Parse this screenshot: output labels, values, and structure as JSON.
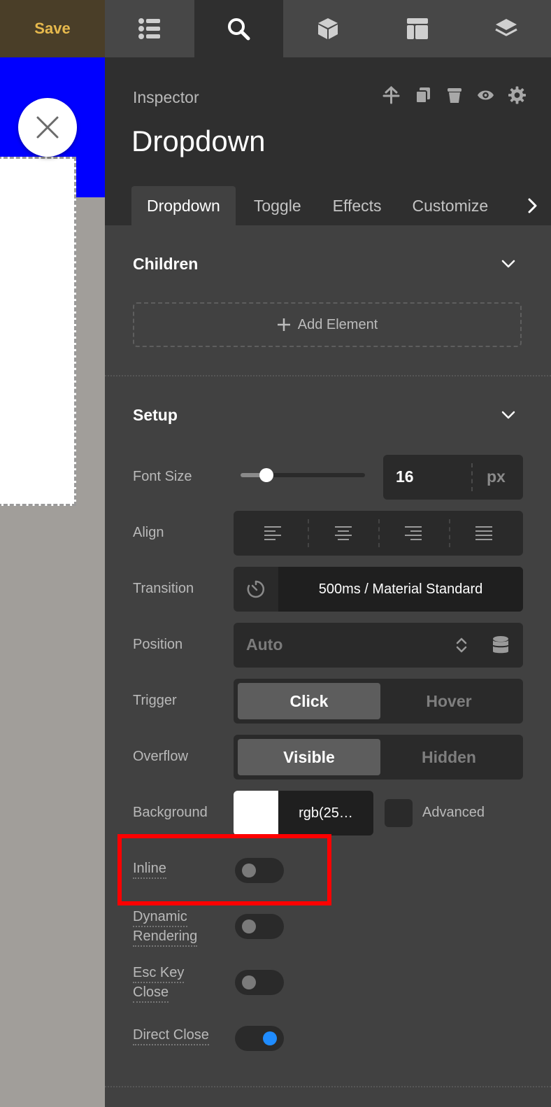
{
  "canvas": {
    "save_label": "Save"
  },
  "topbar": {
    "tabs": [
      "list",
      "search",
      "box",
      "layout",
      "layers"
    ],
    "active": "search"
  },
  "inspector": {
    "label": "Inspector",
    "title": "Dropdown",
    "actions": [
      "move-up-icon",
      "duplicate-icon",
      "delete-icon",
      "visibility-icon",
      "settings-icon"
    ],
    "tabs": [
      "Dropdown",
      "Toggle",
      "Effects",
      "Customize"
    ],
    "active_tab": "Dropdown"
  },
  "children": {
    "title": "Children",
    "add_element": "Add Element"
  },
  "setup": {
    "title": "Setup",
    "font_size": {
      "label": "Font Size",
      "value": "16",
      "unit": "px"
    },
    "align": {
      "label": "Align"
    },
    "transition": {
      "label": "Transition",
      "value": "500ms / Material Standard"
    },
    "position": {
      "label": "Position",
      "value": "Auto"
    },
    "trigger": {
      "label": "Trigger",
      "options": [
        "Click",
        "Hover"
      ],
      "selected": "Click"
    },
    "overflow": {
      "label": "Overflow",
      "options": [
        "Visible",
        "Hidden"
      ],
      "selected": "Visible"
    },
    "background": {
      "label": "Background",
      "value": "rgb(25…",
      "swatch": "#ffffff",
      "advanced_label": "Advanced"
    },
    "inline": {
      "label": "Inline",
      "on": false
    },
    "dynamic_rendering": {
      "label_1": "Dynamic",
      "label_2": "Rendering",
      "on": false
    },
    "esc_key_close": {
      "label_1": "Esc Key",
      "label_2": "Close",
      "on": false
    },
    "direct_close": {
      "label": "Direct Close",
      "on": true
    }
  },
  "colors": {
    "accent_blue": "#1f8cff",
    "save_text": "#e7b94d",
    "highlight": "#ff0000",
    "canvas_blue": "#0000ff"
  }
}
